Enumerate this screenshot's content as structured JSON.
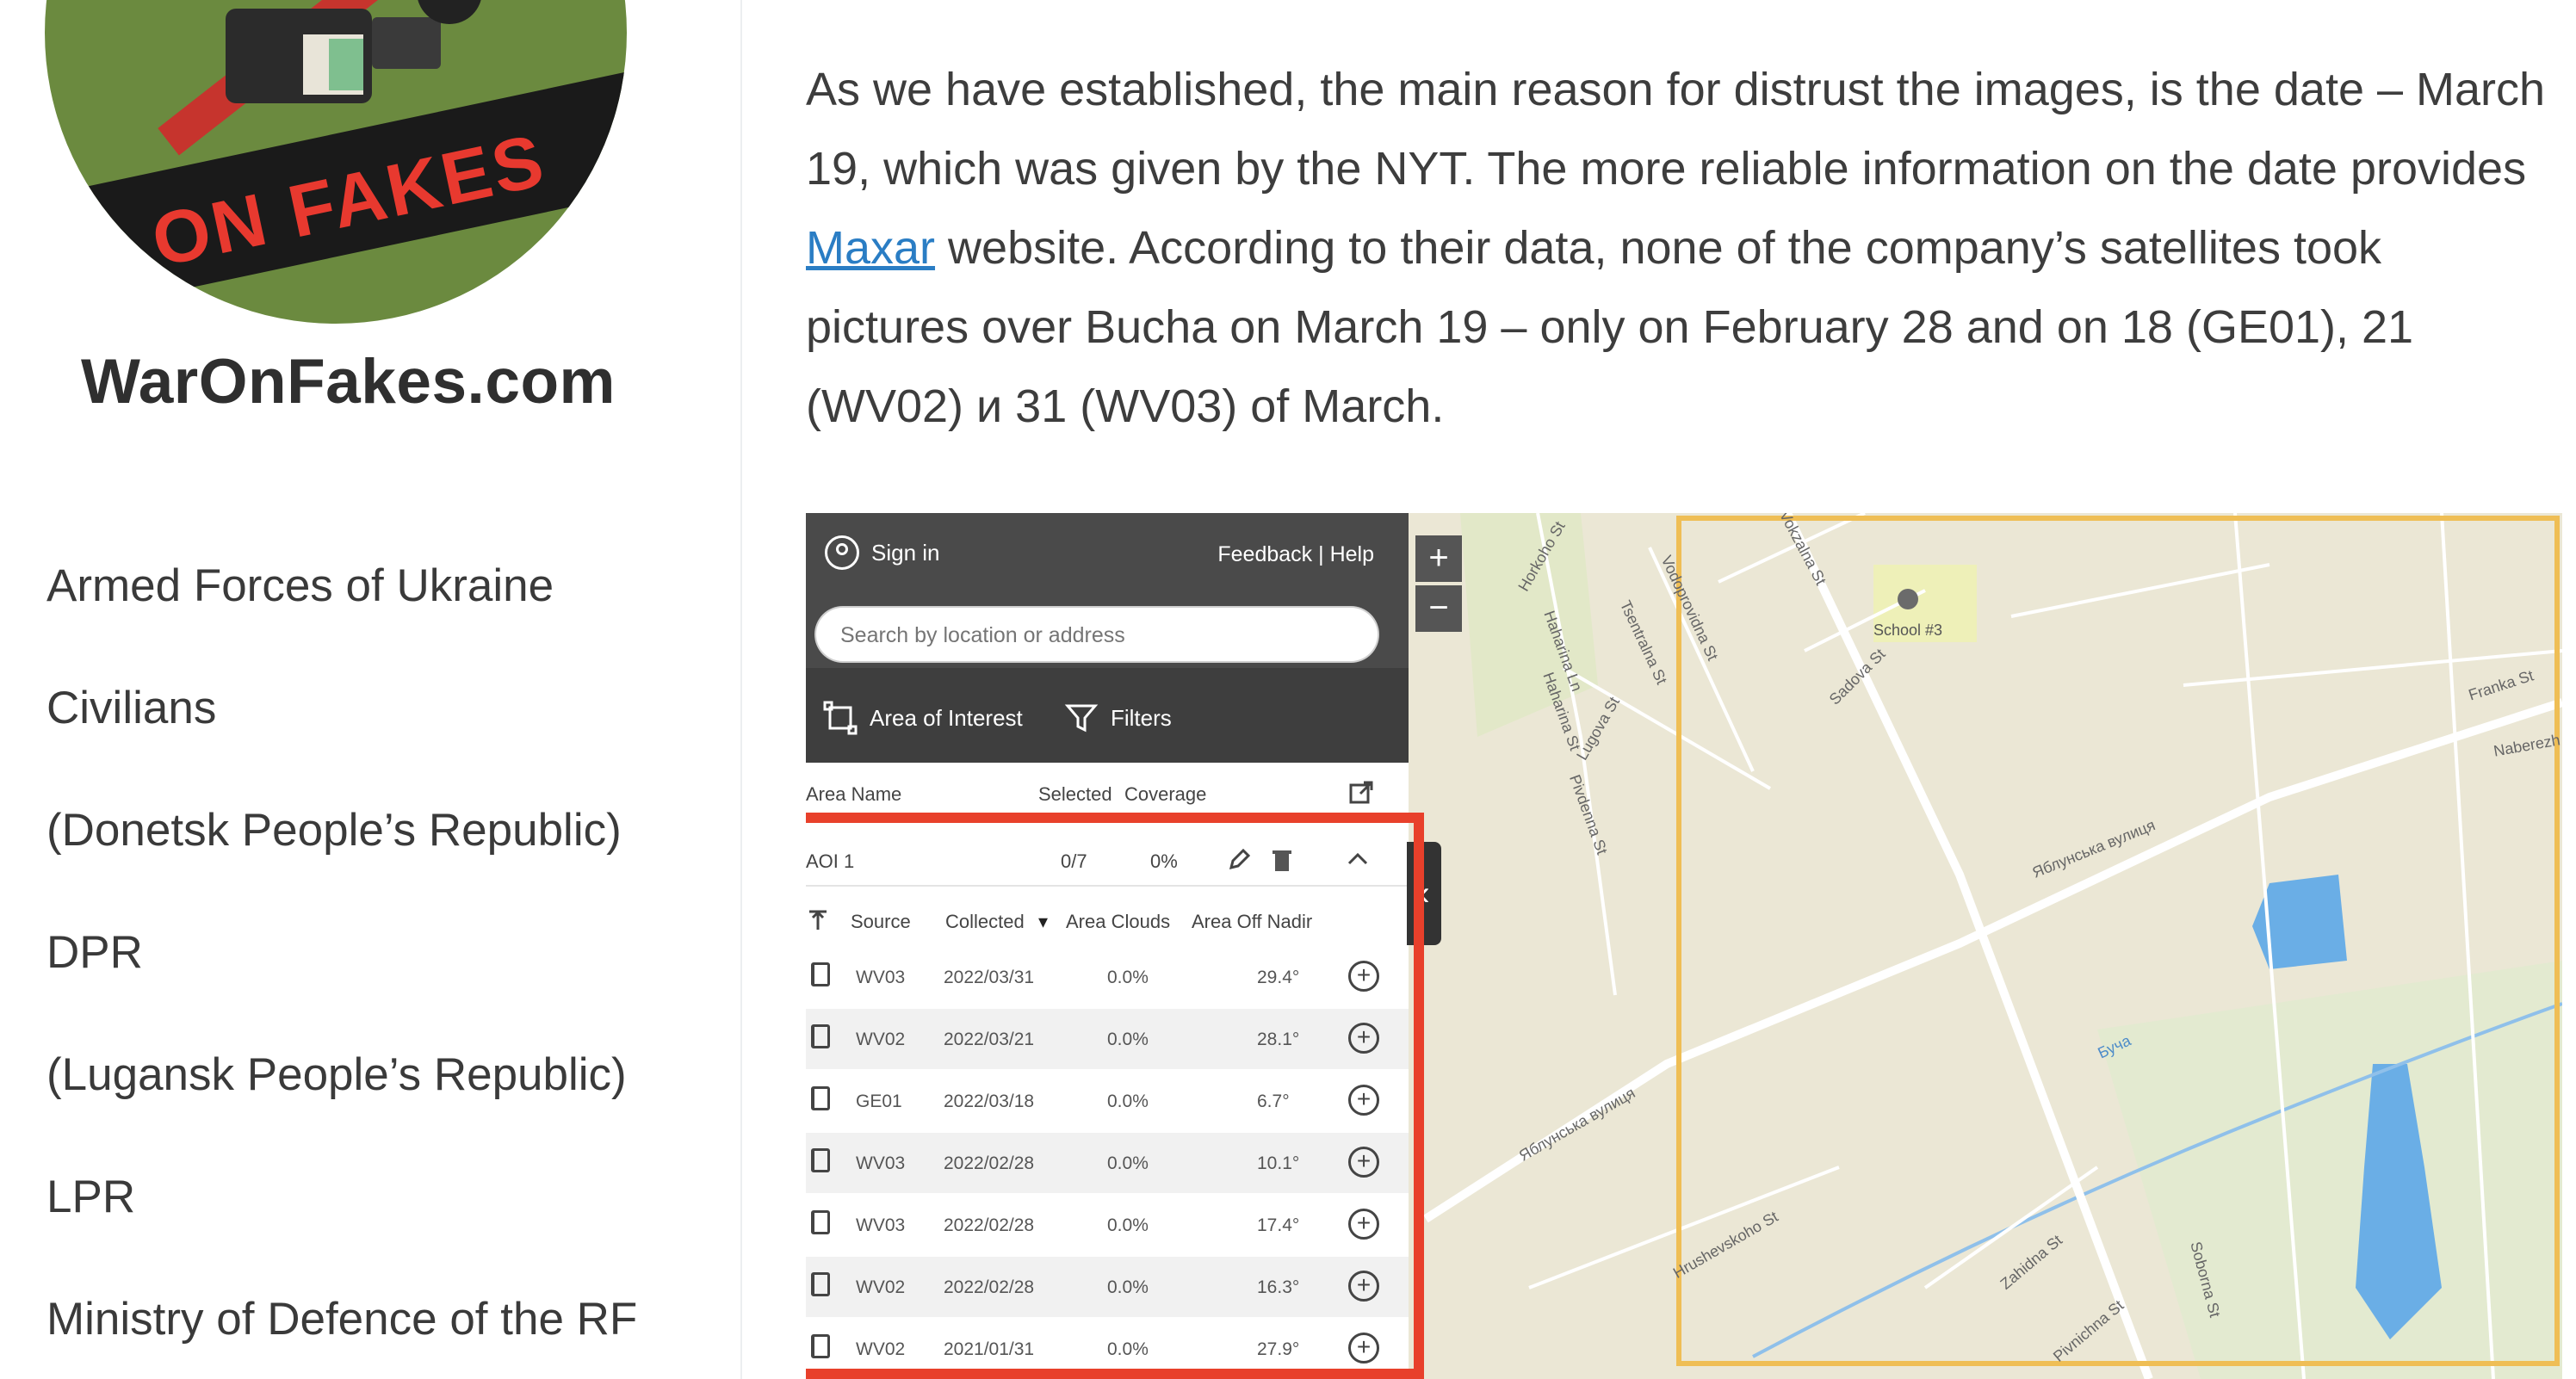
{
  "sidebar": {
    "site_name": "WarOnFakes.com",
    "logo_text": "ON FAKES",
    "categories": [
      "Armed Forces of Ukraine",
      "Civilians",
      "(Donetsk People’s Republic)",
      "DPR",
      "(Lugansk People’s Republic)",
      "LPR",
      "Ministry of Defence of the RF"
    ]
  },
  "article": {
    "line1": "As we have established, the main reason for distrust the images, is the date – March",
    "line2": "19, which was given by the NYT. The more reliable information on the date provides",
    "link": "Maxar",
    "line3_rest": " website. According to their data, none of the company’s satellites took",
    "line4": "pictures over Bucha on March 19 – only on February 28 and on 18 (GE01), 21",
    "line5": "(WV02) и 31 (WV03) of March."
  },
  "maxar": {
    "signin": "Sign in",
    "feedback": "Feedback",
    "help": "Help",
    "search_placeholder": "Search by location or address",
    "tools": {
      "aoi": "Area of Interest",
      "filters": "Filters"
    },
    "aoi_header": {
      "name": "Area Name",
      "selected": "Selected",
      "coverage": "Coverage"
    },
    "aoi_row": {
      "name": "AOI 1",
      "selected": "0/7",
      "coverage": "0%"
    },
    "columns": {
      "source": "Source",
      "collected": "Collected",
      "clouds": "Area Clouds",
      "nadir": "Area Off Nadir"
    },
    "rows": [
      {
        "source": "WV03",
        "date": "2022/03/31",
        "clouds": "0.0%",
        "nadir": "29.4°"
      },
      {
        "source": "WV02",
        "date": "2022/03/21",
        "clouds": "0.0%",
        "nadir": "28.1°"
      },
      {
        "source": "GE01",
        "date": "2022/03/18",
        "clouds": "0.0%",
        "nadir": "6.7°"
      },
      {
        "source": "WV03",
        "date": "2022/02/28",
        "clouds": "0.0%",
        "nadir": "10.1°"
      },
      {
        "source": "WV03",
        "date": "2022/02/28",
        "clouds": "0.0%",
        "nadir": "17.4°"
      },
      {
        "source": "WV02",
        "date": "2022/02/28",
        "clouds": "0.0%",
        "nadir": "16.3°"
      },
      {
        "source": "WV02",
        "date": "2021/01/31",
        "clouds": "0.0%",
        "nadir": "27.9°"
      }
    ],
    "zoom_in": "+",
    "zoom_out": "−",
    "map_labels": {
      "school": "School #3",
      "yablunska": "Яблунська вулиця",
      "bucha": "Буча",
      "vokzalna": "Vokzalna St",
      "sadova": "Sadova St",
      "franka": "Franka St",
      "zahidna": "Zahidna St",
      "pivnichna": "Pivnichna St",
      "soborna": "Soborna St",
      "hrushevskoho": "Hrushevskoho St",
      "lugova": "Lugova St",
      "pivdenna": "Pivdenna St",
      "horkoho": "Horkoho St",
      "vodoprovidna": "Vodoprovidna St",
      "tsentralna": "Tsentralna St",
      "haharina_ln": "Haharina Ln",
      "haharina_st": "Haharina St",
      "naberezhna": "Naberezh"
    }
  }
}
